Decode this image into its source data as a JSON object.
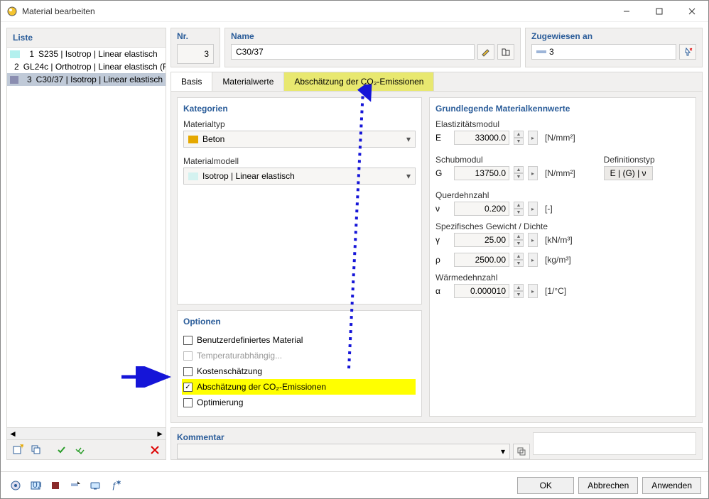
{
  "window": {
    "title": "Material bearbeiten"
  },
  "list": {
    "header": "Liste",
    "items": [
      {
        "idx": "1",
        "swatch": "#b3f0ee",
        "label": "S235 | Isotrop | Linear elastisch"
      },
      {
        "idx": "2",
        "swatch": "#e5a800",
        "label": "GL24c | Orthotrop | Linear elastisch (F..."
      },
      {
        "idx": "3",
        "swatch": "#8a8db0",
        "label": "C30/37 | Isotrop | Linear elastisch"
      }
    ],
    "selected": 2
  },
  "top": {
    "nr_label": "Nr.",
    "nr_value": "3",
    "name_label": "Name",
    "name_value": "C30/37",
    "assign_label": "Zugewiesen an",
    "assign_value": "3"
  },
  "tabs": {
    "items": [
      "Basis",
      "Materialwerte",
      "Abschätzung der CO₂-Emissionen"
    ],
    "active": 0,
    "highlight": 2
  },
  "categories": {
    "title": "Kategorien",
    "type_label": "Materialtyp",
    "type_value": "Beton",
    "type_swatch": "#e5a800",
    "model_label": "Materialmodell",
    "model_value": "Isotrop | Linear elastisch",
    "model_swatch": "#d4f2f0"
  },
  "options": {
    "title": "Optionen",
    "items": [
      {
        "label": "Benutzerdefiniertes Material",
        "checked": false,
        "disabled": false,
        "hl": false
      },
      {
        "label": "Temperaturabhängig...",
        "checked": false,
        "disabled": true,
        "hl": false
      },
      {
        "label": "Kostenschätzung",
        "checked": false,
        "disabled": false,
        "hl": false
      },
      {
        "label": "Abschätzung der CO₂-Emissionen",
        "checked": true,
        "disabled": false,
        "hl": true
      },
      {
        "label": "Optimierung",
        "checked": false,
        "disabled": false,
        "hl": false
      }
    ]
  },
  "props": {
    "title": "Grundlegende Materialkennwerte",
    "e_label": "Elastizitätsmodul",
    "e_sym": "E",
    "e_val": "33000.0",
    "e_unit": "[N/mm²]",
    "g_label": "Schubmodul",
    "g_sym": "G",
    "g_val": "13750.0",
    "g_unit": "[N/mm²]",
    "def_label": "Definitionstyp",
    "def_val": "E | (G) | ν",
    "nu_label": "Querdehnzahl",
    "nu_sym": "ν",
    "nu_val": "0.200",
    "nu_unit": "[-]",
    "sw_label": "Spezifisches Gewicht / Dichte",
    "gamma_sym": "γ",
    "gamma_val": "25.00",
    "gamma_unit": "[kN/m³]",
    "rho_sym": "ρ",
    "rho_val": "2500.00",
    "rho_unit": "[kg/m³]",
    "alpha_label": "Wärmedehnzahl",
    "alpha_sym": "α",
    "alpha_val": "0.000010",
    "alpha_unit": "[1/°C]"
  },
  "comment": {
    "label": "Kommentar"
  },
  "buttons": {
    "ok": "OK",
    "cancel": "Abbrechen",
    "apply": "Anwenden"
  }
}
